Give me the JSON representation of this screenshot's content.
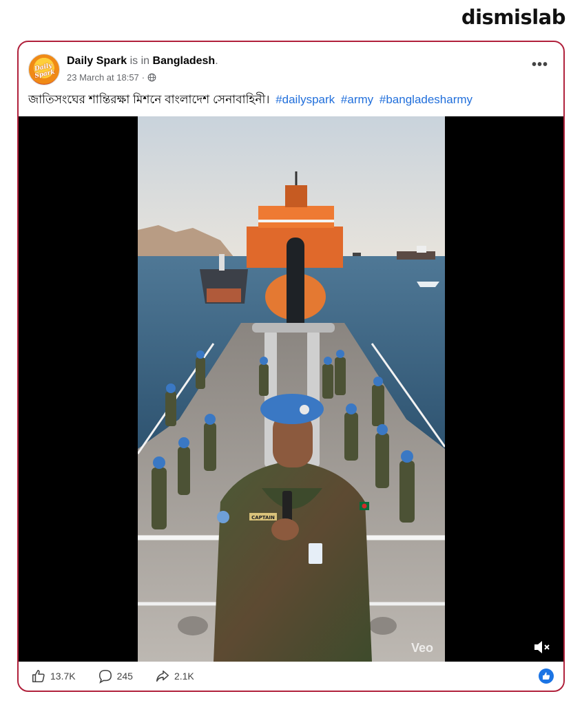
{
  "watermark": "dismislab",
  "post": {
    "page_name": "Daily Spark",
    "is_in": "is in",
    "location": "Bangladesh",
    "period": ".",
    "avatar_text": "Daily Spark",
    "timestamp": "23 March at 18:57",
    "separator": "·",
    "more_label": "•••",
    "caption_text": "জাতিসংঘের শান্তিরক্ষা মিশনে বাংলাদেশ সেনাবাহিনী।",
    "hashtags": [
      "#dailyspark",
      "#army",
      "#bangladesharmy"
    ]
  },
  "video": {
    "veo_watermark": "Veo",
    "captain_tag": "CAPTAIN",
    "muted": true
  },
  "reactions": {
    "likes": "13.7K",
    "comments": "245",
    "shares": "2.1K"
  },
  "colors": {
    "card_border": "#b0203b",
    "hashtag": "#216fdb",
    "like_badge": "#1b74e4",
    "beret": "#3a78c4"
  }
}
